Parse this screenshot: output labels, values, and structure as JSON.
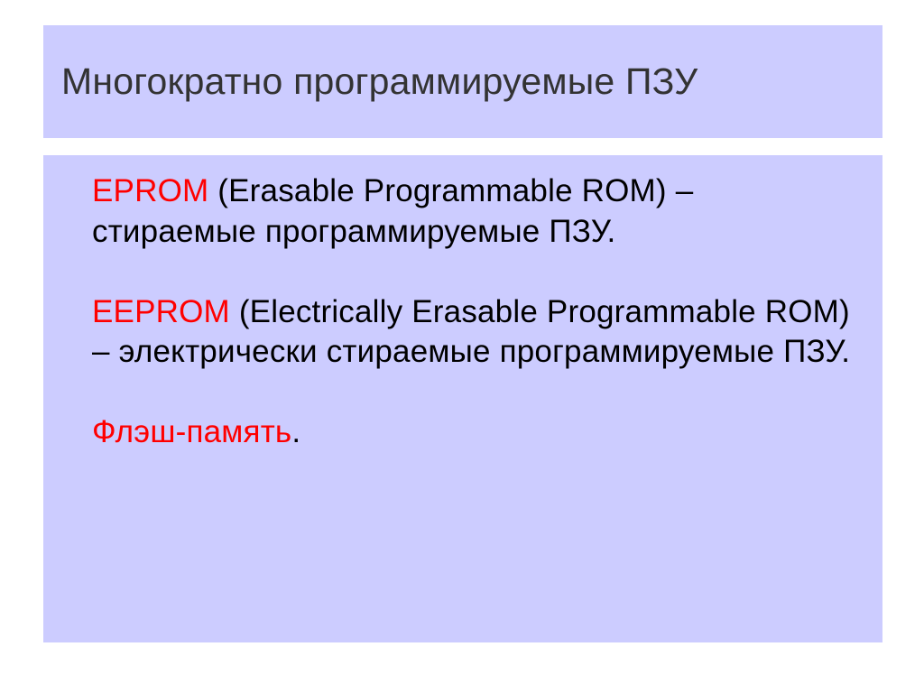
{
  "title": "Многократно программируемые ПЗУ",
  "items": [
    {
      "term": "EPROM",
      "desc": " (Erasable Programmable ROM) – стираемые программируемые ПЗУ."
    },
    {
      "term": "EEPROM",
      "desc": " (Electrically Erasable Programmable ROM) – электрически стираемые программируемые ПЗУ."
    },
    {
      "term": "Флэш-память",
      "desc": "."
    }
  ],
  "colors": {
    "panel_bg": "#ccccff",
    "term_color": "#ff0000",
    "body_text": "#000000",
    "title_text": "#333333"
  }
}
